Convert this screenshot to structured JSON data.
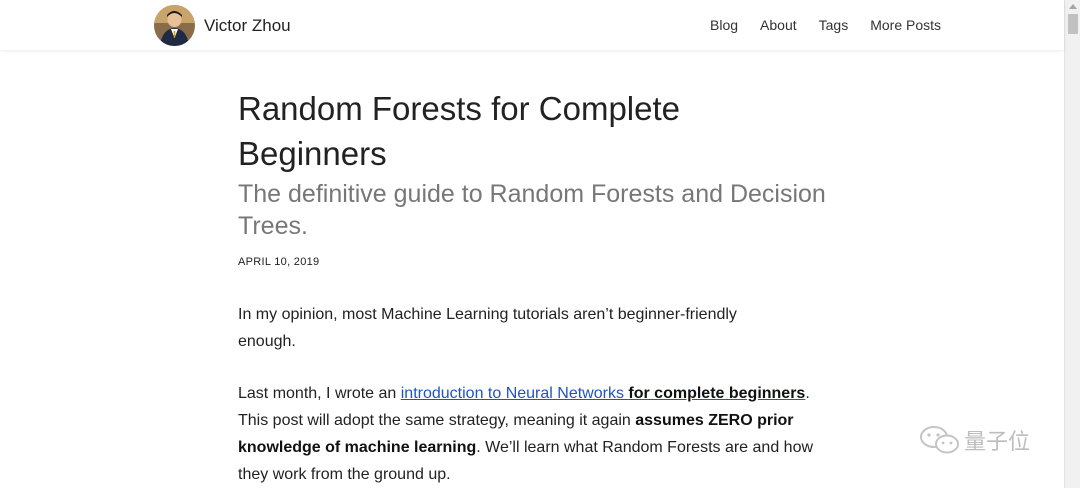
{
  "header": {
    "site_name": "Victor Zhou",
    "nav": [
      "Blog",
      "About",
      "Tags",
      "More Posts"
    ]
  },
  "article": {
    "title": "Random Forests for Complete Beginners",
    "subtitle": "The definitive guide to Random Forests and Decision Trees.",
    "date": "APRIL 10, 2019",
    "para1": "In my opinion, most Machine Learning tutorials aren’t beginner-friendly enough.",
    "para2": {
      "t1": "Last month, I wrote an ",
      "link_text": "introduction to Neural Networks ",
      "link_bold": "for complete beginners",
      "t2": ". This post will adopt the same strategy, meaning it again ",
      "b1": "assumes ZERO prior knowledge of machine learning",
      "t3": ". We’ll learn what Random Forests are and how they work from the ground up."
    }
  },
  "watermark": {
    "text": "量子位"
  },
  "colors": {
    "link": "#1a56c2",
    "subtitle": "#777777",
    "text": "#222222"
  }
}
